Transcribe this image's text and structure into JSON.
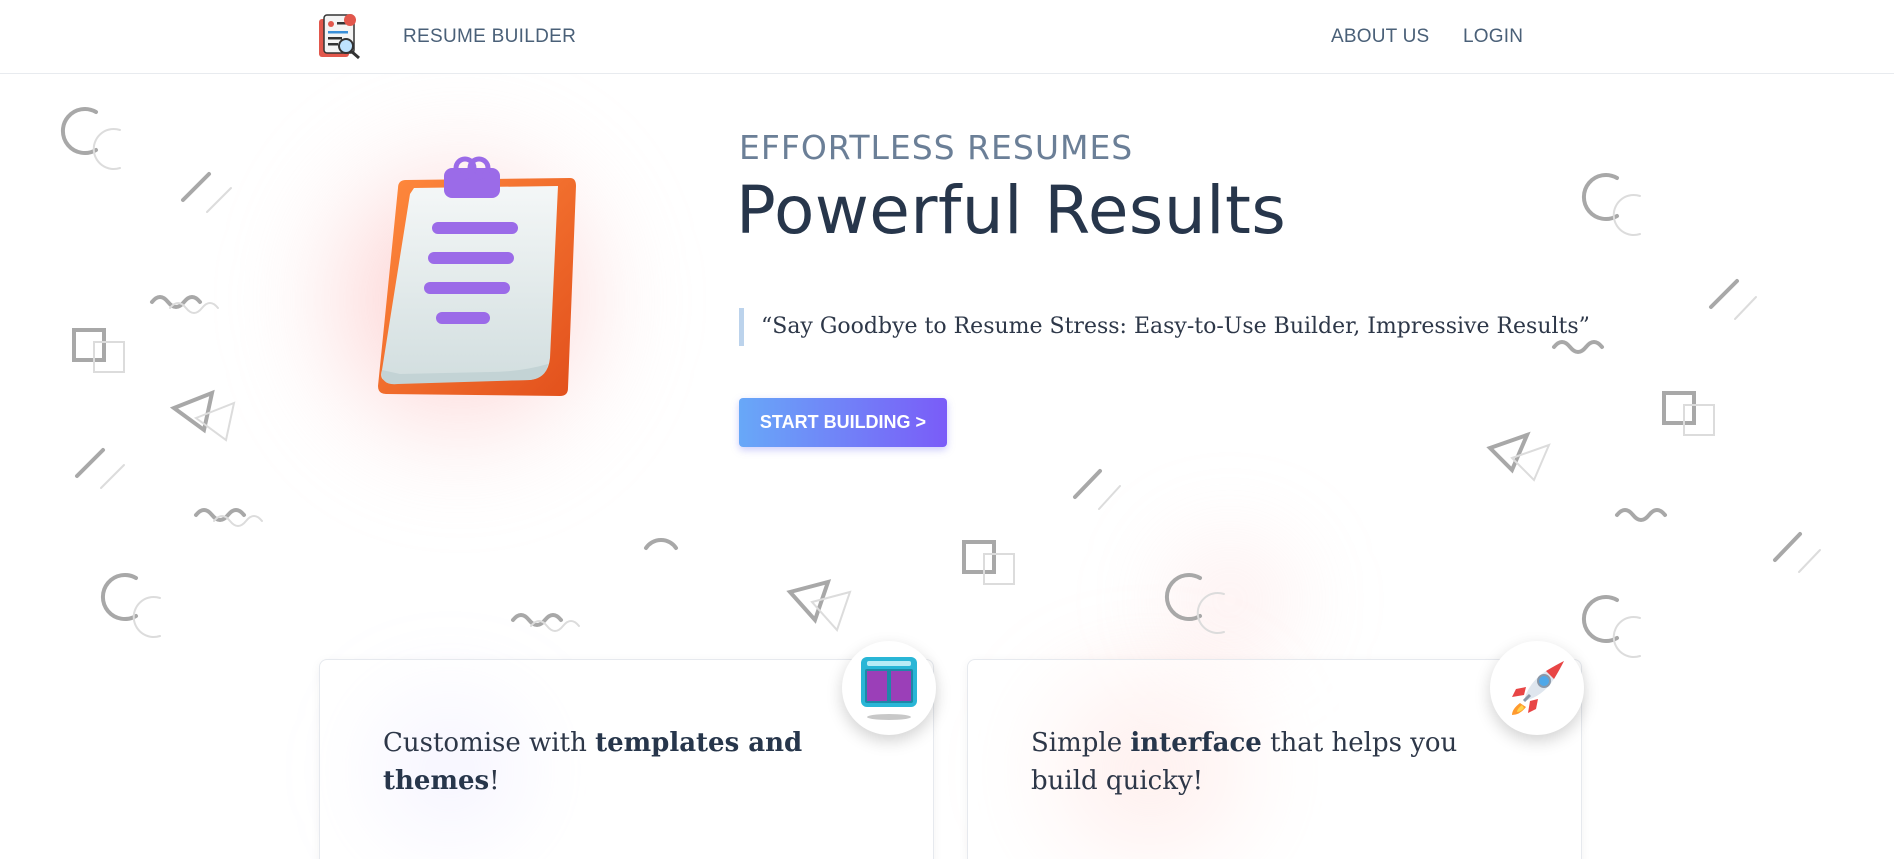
{
  "nav": {
    "brand": "RESUME BUILDER",
    "links": [
      "ABOUT US",
      "LOGIN"
    ],
    "logo_icon": "resume-magnifier-icon"
  },
  "hero": {
    "tagline": "EFFORTLESS RESUMES",
    "headline": "Powerful Results",
    "quote": "“Say Goodbye to Resume Stress: Easy-to-Use Builder, Impressive Results”",
    "cta": "START BUILDING >",
    "illustration": "clipboard-icon"
  },
  "features": [
    {
      "pre": "Customise with ",
      "bold": "templates and themes",
      "post": "!",
      "icon": "template-layout-icon"
    },
    {
      "pre": "Simple ",
      "bold": "interface",
      "post": " that helps you build quicky!",
      "icon": "rocket-icon"
    }
  ],
  "colors": {
    "cta_start": "#68a8f8",
    "cta_end": "#7a5cf8",
    "nav_text": "#4a6078",
    "headline": "#27364b"
  }
}
